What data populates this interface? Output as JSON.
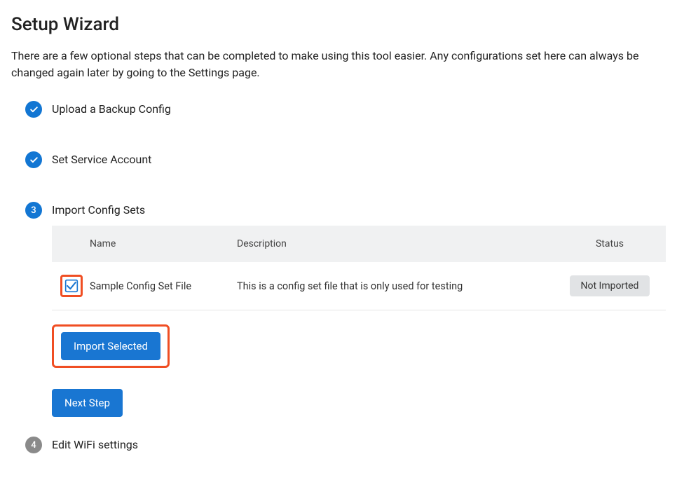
{
  "page": {
    "title": "Setup Wizard",
    "description": "There are a few optional steps that can be completed to make using this tool easier. Any configurations set here can always be changed again later by going to the Settings page."
  },
  "steps": {
    "step1": {
      "label": "Upload a Backup Config",
      "status": "done"
    },
    "step2": {
      "label": "Set Service Account",
      "status": "done"
    },
    "step3": {
      "label": "Import Config Sets",
      "number": "3",
      "status": "current"
    },
    "step4": {
      "label": "Edit WiFi settings",
      "number": "4",
      "status": "pending"
    }
  },
  "config_table": {
    "headers": {
      "name": "Name",
      "description": "Description",
      "status": "Status"
    },
    "rows": [
      {
        "checked": true,
        "name": "Sample Config Set File",
        "description": "This is a config set file that is only used for testing",
        "status": "Not Imported"
      }
    ]
  },
  "buttons": {
    "import_selected": "Import Selected",
    "next_step": "Next Step"
  }
}
